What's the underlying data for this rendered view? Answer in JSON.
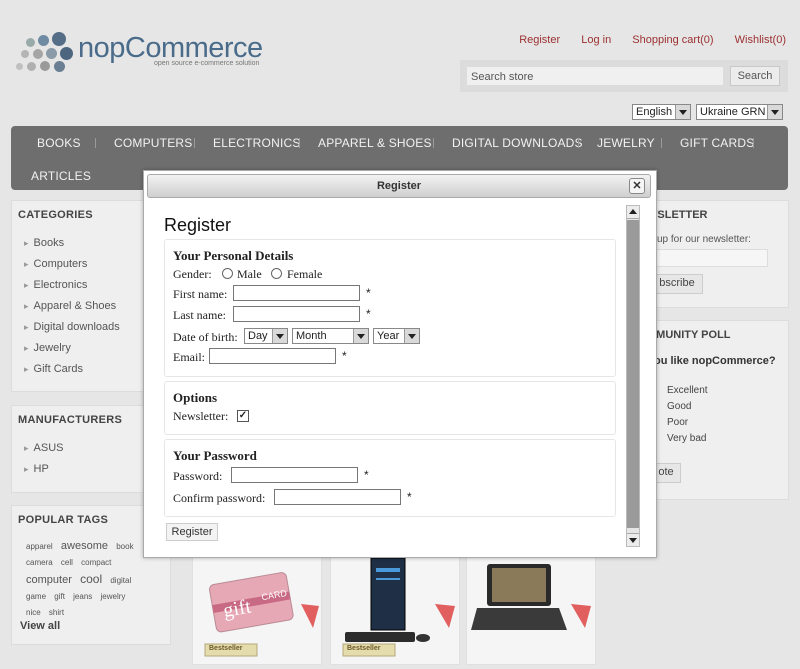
{
  "logo": {
    "name": "nopCommerce",
    "tagline": "open source e-commerce solution"
  },
  "header": {
    "links": [
      "Register",
      "Log in",
      "Shopping cart(0)",
      "Wishlist(0)"
    ]
  },
  "search": {
    "placeholder": "Search store",
    "button": "Search"
  },
  "selectors": {
    "language": "English",
    "currency": "Ukraine GRN"
  },
  "nav": {
    "items": [
      "BOOKS",
      "COMPUTERS",
      "ELECTRONICS",
      "APPAREL & SHOES",
      "DIGITAL DOWNLOADS",
      "JEWELRY",
      "GIFT CARDS",
      "ARTICLES"
    ]
  },
  "categories": {
    "title": "CATEGORIES",
    "items": [
      "Books",
      "Computers",
      "Electronics",
      "Apparel & Shoes",
      "Digital downloads",
      "Jewelry",
      "Gift Cards"
    ]
  },
  "manufacturers": {
    "title": "MANUFACTURERS",
    "items": [
      "ASUS",
      "HP"
    ]
  },
  "popular_tags": {
    "title": "POPULAR TAGS",
    "tags": [
      "apparel",
      "awesome",
      "book",
      "camera",
      "cell",
      "compact",
      "computer",
      "cool",
      "digital",
      "game",
      "gift",
      "jeans",
      "jewelry",
      "nice",
      "shirt"
    ],
    "view_all": "View all"
  },
  "newsletter": {
    "title": "WSLETTER",
    "text": "up for our newsletter:",
    "button": "bscribe"
  },
  "poll": {
    "title": "MMUNITY POLL",
    "question": "ou like nopCommerce?",
    "options": [
      "Excellent",
      "Good",
      "Poor",
      "Very bad"
    ],
    "button": "ote"
  },
  "products": {
    "badge": "Bestseller"
  },
  "modal": {
    "window_title": "Register",
    "heading": "Register",
    "personal": {
      "title": "Your Personal Details",
      "gender_label": "Gender:",
      "male": "Male",
      "female": "Female",
      "first_name": "First name:",
      "last_name": "Last name:",
      "dob": "Date of birth:",
      "day": "Day",
      "month": "Month",
      "year": "Year",
      "email": "Email:"
    },
    "options": {
      "title": "Options",
      "newsletter": "Newsletter:",
      "newsletter_checked": true
    },
    "password": {
      "title": "Your Password",
      "password": "Password:",
      "confirm": "Confirm password:"
    },
    "required_mark": "*",
    "submit": "Register"
  }
}
